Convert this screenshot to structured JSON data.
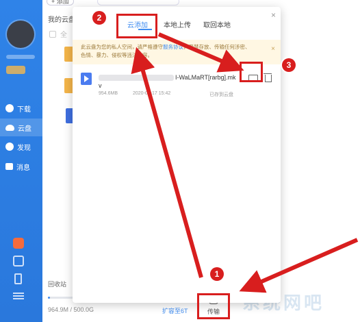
{
  "sidebar": {
    "items": [
      {
        "label": "下载",
        "icon": "download-icon"
      },
      {
        "label": "云盘",
        "icon": "cloud-icon",
        "active": true
      },
      {
        "label": "发现",
        "icon": "compass-icon"
      },
      {
        "label": "消息",
        "icon": "message-icon"
      }
    ],
    "accent": "#2f83e8"
  },
  "main": {
    "add_label": "+ 添加",
    "breadcrumb": "我的云盘",
    "select_all": "全",
    "recycle": "回收站",
    "storage": "964.9M / 500.0G",
    "storage_fraction": 0.0019,
    "expand": "扩容至6T",
    "transfer": "传输"
  },
  "popup": {
    "tabs": [
      "云添加",
      "本地上传",
      "取回本地"
    ],
    "active_tab": "云添加",
    "notice": {
      "line1_a": "此云盘为您的私人空间，请严格遵守",
      "line1_link": "服务协议",
      "line1_b": "，严禁存放、传输任何涉密、",
      "line2": "色情、暴力、侵权等违法内容。"
    },
    "file": {
      "name_tail": "I-WaLMaRT[rarbg].mk",
      "name_line2": "v",
      "size": "954.6MB",
      "date": "2020-05-17 15:42",
      "status": "已存到云盘"
    }
  },
  "annotations": {
    "colors": {
      "red": "#d81e1e"
    },
    "badges": [
      "1",
      "2",
      "3"
    ]
  },
  "watermark": "系统网吧"
}
